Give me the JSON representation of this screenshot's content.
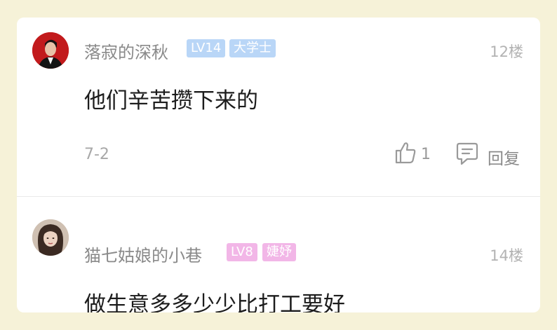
{
  "comments": [
    {
      "username": "落寂的深秋",
      "level": "LV14",
      "title_badge": "大学士",
      "floor": "12楼",
      "content": "他们辛苦攒下来的",
      "date": "7-2",
      "like_count": "1",
      "reply_label": "回复",
      "badge_color": "#b9d6f7"
    },
    {
      "username": "猫七姑娘的小巷",
      "level": "LV8",
      "title_badge": "婕妤",
      "floor": "14楼",
      "content": "做生意多多少少比打工要好",
      "badge_color": "#f2b6e7"
    }
  ],
  "colors": {
    "page_background": "#f6f2d8",
    "card_background": "#ffffff",
    "username": "#8a8a8a",
    "content_text": "#1c1c1c",
    "meta_text": "#a8a8a8"
  }
}
